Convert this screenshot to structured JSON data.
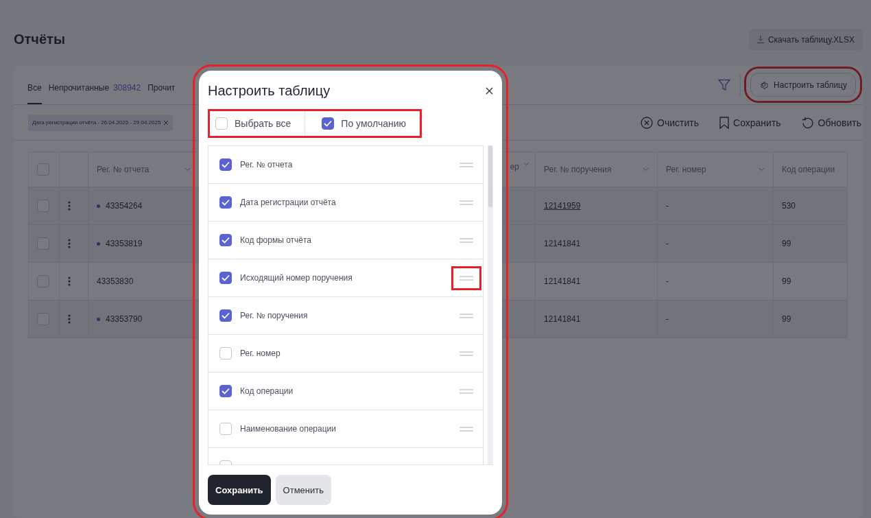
{
  "page": {
    "title": "Отчёты",
    "download_button": "Скачать таблицу.XLSX"
  },
  "tabs": [
    {
      "label": "Все",
      "selected": true
    },
    {
      "label": "Непрочитанные",
      "count": "308942",
      "selected": false
    },
    {
      "label": "Прочит",
      "selected": false
    }
  ],
  "configure_button": {
    "label": "Настроить таблицу",
    "highlighted": true
  },
  "filter_chip": "Дата регистрации отчёта - 26.04.2025 - 29.04.2025",
  "actions": [
    {
      "kind": "clear",
      "label": "Очистить"
    },
    {
      "kind": "save",
      "label": "Сохранить"
    },
    {
      "kind": "refresh",
      "label": "Обновить"
    }
  ],
  "table": {
    "header_checkbox": {
      "checked": false
    },
    "columns": [
      {
        "label": "Рег. № отчета",
        "sortable": true
      },
      {
        "label": "ер",
        "sortable": true
      },
      {
        "label": "Рег. № поручения",
        "sortable": true
      },
      {
        "label": "Рег. номер",
        "sortable": true
      },
      {
        "label": "Код операции"
      }
    ],
    "rows": [
      {
        "unread": true,
        "checked": false,
        "report_no": "43354264",
        "order_no": "12141959",
        "order_link": true,
        "reg_no": "-",
        "op_code": "530"
      },
      {
        "unread": true,
        "checked": false,
        "report_no": "43353819",
        "order_no": "12141841",
        "order_link": false,
        "reg_no": "-",
        "op_code": "99"
      },
      {
        "unread": false,
        "checked": false,
        "report_no": "43353830",
        "order_no": "12141841",
        "order_link": false,
        "reg_no": "-",
        "op_code": "99"
      },
      {
        "unread": true,
        "checked": false,
        "report_no": "43353790",
        "order_no": "12141841",
        "order_link": false,
        "reg_no": "-",
        "op_code": "99"
      }
    ]
  },
  "modal": {
    "title": "Настроить таблицу",
    "highlighted": true,
    "toggles_highlighted": true,
    "select_all": {
      "label": "Выбрать все",
      "checked": false
    },
    "default": {
      "label": "По умолчанию",
      "checked": true
    },
    "columns": [
      {
        "label": "Рег. № отчета",
        "checked": true,
        "handle_highlighted": false
      },
      {
        "label": "Дата регистрации отчёта",
        "checked": true,
        "handle_highlighted": false
      },
      {
        "label": "Код формы отчёта",
        "checked": true,
        "handle_highlighted": false
      },
      {
        "label": "Исходящий номер поручения",
        "checked": true,
        "handle_highlighted": true
      },
      {
        "label": "Рег. № поручения",
        "checked": true,
        "handle_highlighted": false
      },
      {
        "label": "Рег. номер",
        "checked": false,
        "handle_highlighted": false
      },
      {
        "label": "Код операции",
        "checked": true,
        "handle_highlighted": false
      },
      {
        "label": "Наименование операции",
        "checked": false,
        "handle_highlighted": false
      }
    ],
    "cut_row": {
      "checked": false
    },
    "buttons": [
      {
        "kind": "primary",
        "label": "Сохранить"
      },
      {
        "kind": "secondary",
        "label": "Отменить"
      }
    ]
  }
}
